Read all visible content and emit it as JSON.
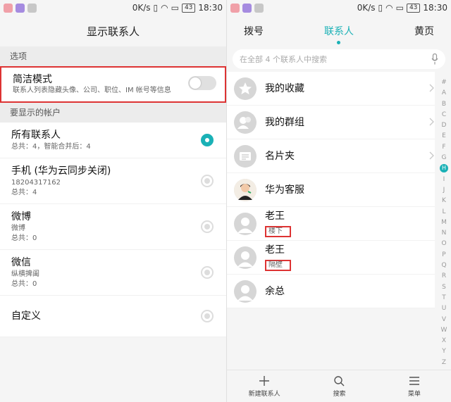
{
  "status_bar": {
    "speed": "0K/s",
    "battery": "43",
    "time": "18:30"
  },
  "left": {
    "title": "显示联系人",
    "options_header": "选项",
    "concise_mode": {
      "title": "简洁模式",
      "subtitle": "联系人列表隐藏头像、公司、职位、IM 帐号等信息",
      "enabled": false
    },
    "accounts_header": "要显示的帐户",
    "accounts": [
      {
        "title": "所有联系人",
        "lines": [
          "总共：4，智能合并后：4"
        ],
        "selected": true
      },
      {
        "title": "手机 (华为云同步关闭)",
        "lines": [
          "18204317162",
          "总共：4"
        ],
        "selected": false
      },
      {
        "title": "微博",
        "lines": [
          "微博",
          "总共：0"
        ],
        "selected": false
      },
      {
        "title": "微信",
        "lines": [
          "纵横捭阖",
          "总共：0"
        ],
        "selected": false
      },
      {
        "title": "自定义",
        "lines": [],
        "selected": false
      }
    ]
  },
  "right": {
    "tabs": [
      "拨号",
      "联系人",
      "黄页"
    ],
    "active_tab": 1,
    "search_placeholder": "在全部 4 个联系人中搜索",
    "contacts": [
      {
        "name": "我的收藏",
        "icon": "star-icon"
      },
      {
        "name": "我的群组",
        "icon": "group-icon"
      },
      {
        "name": "名片夹",
        "icon": "card-holder-icon"
      },
      {
        "name": "华为客服",
        "icon": "service-avatar"
      },
      {
        "name": "老王",
        "note": "楼下",
        "icon": "person-icon"
      },
      {
        "name": "老王",
        "note": "隔壁",
        "icon": "person-icon"
      },
      {
        "name": "余总",
        "icon": "person-icon"
      }
    ],
    "index_letters": [
      "#",
      "A",
      "B",
      "C",
      "D",
      "E",
      "F",
      "G",
      "H",
      "I",
      "J",
      "K",
      "L",
      "M",
      "N",
      "O",
      "P",
      "Q",
      "R",
      "S",
      "T",
      "U",
      "V",
      "W",
      "X",
      "Y",
      "Z"
    ],
    "index_active": "H",
    "bottom": {
      "new_contact": "新建联系人",
      "search": "搜索",
      "menu": "菜单"
    }
  },
  "colors": {
    "accent": "#1ab1b6",
    "highlight_border": "#dd3333"
  }
}
